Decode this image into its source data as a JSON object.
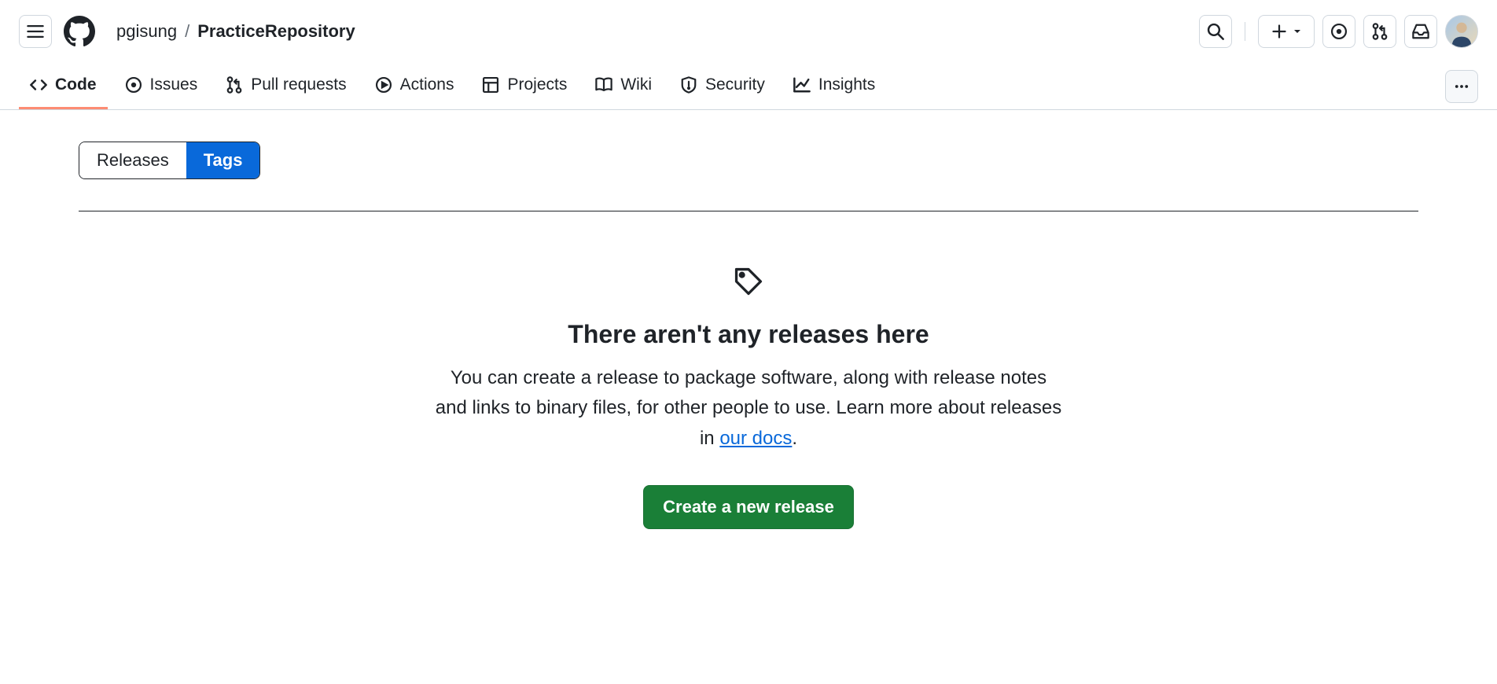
{
  "breadcrumbs": {
    "owner": "pgisung",
    "separator": "/",
    "repo": "PracticeRepository"
  },
  "repo_nav": {
    "code": "Code",
    "issues": "Issues",
    "pull_requests": "Pull requests",
    "actions": "Actions",
    "projects": "Projects",
    "wiki": "Wiki",
    "security": "Security",
    "insights": "Insights"
  },
  "subtabs": {
    "releases": "Releases",
    "tags": "Tags"
  },
  "empty": {
    "title": "There aren't any releases here",
    "desc_pre": "You can create a release to package software, along with release notes and links to binary files, for other people to use. Learn more about releases in ",
    "link": "our docs",
    "desc_post": ".",
    "button": "Create a new release"
  }
}
